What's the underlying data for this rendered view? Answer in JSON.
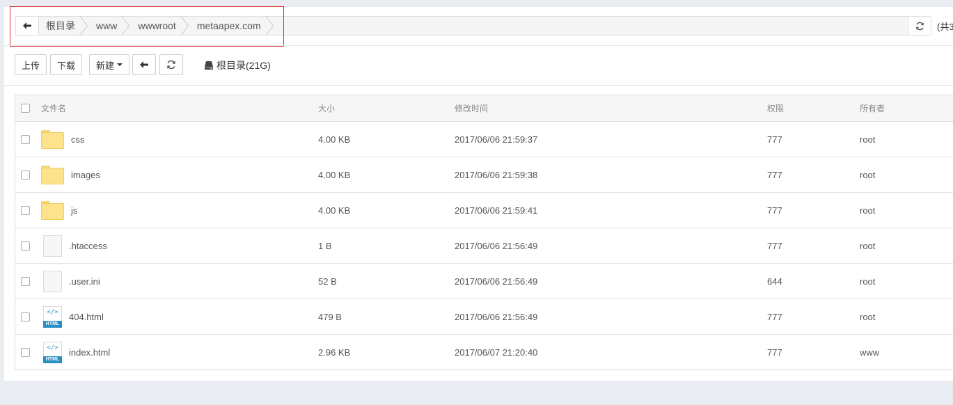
{
  "breadcrumb": {
    "items": [
      "根目录",
      "www",
      "wwwroot",
      "metaapex.com"
    ],
    "total_text": "(共3"
  },
  "toolbar": {
    "upload_label": "上传",
    "download_label": "下载",
    "new_label": "新建",
    "disk_label": "根目录(21G)"
  },
  "table": {
    "headers": {
      "name": "文件名",
      "size": "大小",
      "mtime": "修改时间",
      "perm": "权限",
      "owner": "所有者"
    },
    "rows": [
      {
        "type": "folder",
        "name": "css",
        "size": "4.00 KB",
        "mtime": "2017/06/06 21:59:37",
        "perm": "777",
        "owner": "root"
      },
      {
        "type": "folder",
        "name": "images",
        "size": "4.00 KB",
        "mtime": "2017/06/06 21:59:38",
        "perm": "777",
        "owner": "root"
      },
      {
        "type": "folder",
        "name": "js",
        "size": "4.00 KB",
        "mtime": "2017/06/06 21:59:41",
        "perm": "777",
        "owner": "root"
      },
      {
        "type": "file",
        "name": ".htaccess",
        "size": "1 B",
        "mtime": "2017/06/06 21:56:49",
        "perm": "777",
        "owner": "root"
      },
      {
        "type": "file",
        "name": ".user.ini",
        "size": "52 B",
        "mtime": "2017/06/06 21:56:49",
        "perm": "644",
        "owner": "root"
      },
      {
        "type": "html",
        "name": "404.html",
        "size": "479 B",
        "mtime": "2017/06/06 21:56:49",
        "perm": "777",
        "owner": "root"
      },
      {
        "type": "html",
        "name": "index.html",
        "size": "2.96 KB",
        "mtime": "2017/06/07 21:20:40",
        "perm": "777",
        "owner": "www"
      }
    ]
  },
  "icons": {
    "back": "arrow-left-icon",
    "refresh": "refresh-icon",
    "disk": "hard-drive-icon",
    "folder": "folder-icon",
    "file": "file-icon",
    "html": "html-file-icon"
  },
  "html_icon": {
    "code": "</>",
    "badge": "HTML"
  },
  "colors": {
    "highlight": "#dd3333",
    "folder": "#fde38b",
    "html_badge": "#2a8fc2"
  }
}
